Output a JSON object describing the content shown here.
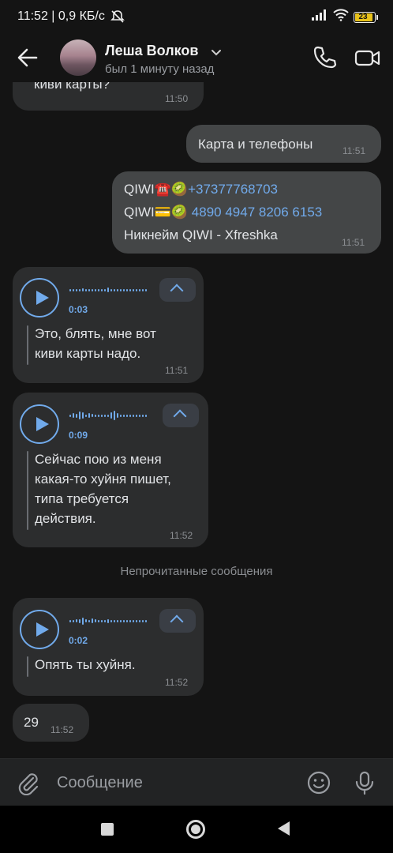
{
  "status_bar": {
    "time_speed": "11:52 | 0,9 КБ/с",
    "battery_level": "23"
  },
  "header": {
    "name": "Леша Волков",
    "status": "был 1 минуту назад"
  },
  "messages": {
    "m0": {
      "text": "киви карты?",
      "time": "11:50"
    },
    "m1": {
      "text": "Карта и телефоны",
      "time": "11:51"
    },
    "m2": {
      "line1_prefix": "QIWI",
      "line1_emoji": "☎️🥝",
      "line1_link": "+37377768703",
      "line2_prefix": "QIWI",
      "line2_emoji": "💳🥝",
      "line2_link": "4890 4947 8206 6153",
      "line3": "Никнейм QIWI - Xfreshka",
      "time": "11:51"
    },
    "v1": {
      "duration": "0:03",
      "line1": "Это, блять, мне вот",
      "line2": "киви карты надо.",
      "time": "11:51"
    },
    "v2": {
      "duration": "0:09",
      "line1": "Сейчас пою из меня",
      "line2": "какая-то хуйня пишет,",
      "line3": "типа требуется",
      "line4": "действия.",
      "time": "11:52"
    },
    "unread_divider": "Непрочитанные сообщения",
    "v3": {
      "duration": "0:02",
      "line1": "Опять ты хуйня.",
      "time": "11:52"
    },
    "m3": {
      "text": "29",
      "time": "11:52"
    }
  },
  "composer": {
    "placeholder": "Сообщение"
  },
  "icons": {
    "back": "arrow-left-icon",
    "call": "phone-icon",
    "video": "video-camera-icon",
    "attach": "paperclip-icon",
    "sticker": "smile-icon",
    "mic": "microphone-icon"
  },
  "colors": {
    "accent": "#71aaeb",
    "incoming_bubble": "#2c2d2e",
    "outgoing_bubble": "#444647",
    "background": "#141414"
  }
}
